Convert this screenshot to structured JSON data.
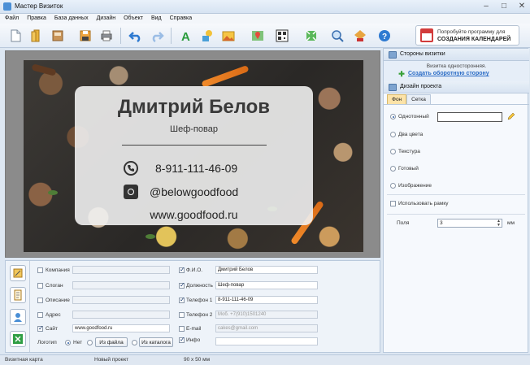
{
  "window": {
    "title": "Мастер Визиток"
  },
  "menu": [
    "Файл",
    "Правка",
    "База данных",
    "Дизайн",
    "Объект",
    "Вид",
    "Справка"
  ],
  "toolbar": {
    "icons": [
      "new-file-icon",
      "open-folder-icon",
      "templates-icon",
      "save-icon",
      "print-icon",
      "undo-icon",
      "redo-icon",
      "text-icon",
      "shapes-icon",
      "image-icon",
      "map-icon",
      "qr-code-icon",
      "fit-icon",
      "zoom-icon",
      "export-icon",
      "help-icon"
    ],
    "promo_line1": "Попробуйте программу для",
    "promo_line2": "СОЗДАНИЯ КАЛЕНДАРЕЙ"
  },
  "card": {
    "name": "Дмитрий Белов",
    "position": "Шеф-повар",
    "phone": "8-911-111-46-09",
    "instagram": "@belowgoodfood",
    "site": "www.goodfood.ru"
  },
  "right_panel": {
    "sides_header": "Стороны визитки",
    "sides_info": "Визитка односторонняя.",
    "sides_link": "Создать оборотную сторону",
    "design_header": "Дизайн проекта",
    "tabs": [
      "Фон",
      "Сетка"
    ],
    "background_options": [
      "Однотонный",
      "Два цвета",
      "Текстура",
      "Готовый",
      "Изображение"
    ],
    "selected_option": "Однотонный",
    "use_frame_label": "Использовать рамку",
    "margins_label": "Поля",
    "margins_value": "3",
    "margins_unit": "мм"
  },
  "fields": {
    "left": [
      {
        "label": "Компания",
        "value": "",
        "checked": false
      },
      {
        "label": "Слоган",
        "value": "",
        "checked": false
      },
      {
        "label": "Описание",
        "value": "",
        "checked": false
      },
      {
        "label": "Адрес",
        "value": "",
        "checked": false
      },
      {
        "label": "Сайт",
        "value": "www.goodfood.ru",
        "checked": true
      }
    ],
    "right": [
      {
        "label": "Ф.И.О.",
        "value": "Дмитрий Белов",
        "placeholder": "",
        "checked": true
      },
      {
        "label": "Должность",
        "value": "Шеф-повар",
        "placeholder": "",
        "checked": true
      },
      {
        "label": "Телефон 1",
        "value": "8-911-111-46-09",
        "placeholder": "",
        "checked": true
      },
      {
        "label": "Телефон 2",
        "value": "",
        "placeholder": "Моб. +7(910)1501240",
        "checked": false
      },
      {
        "label": "E-mail",
        "value": "",
        "placeholder": "cakes@gmail.com",
        "checked": false
      },
      {
        "label": "Инфо",
        "value": "",
        "placeholder": "",
        "checked": true
      }
    ],
    "logo_label": "Логотип",
    "logo_no": "Нет",
    "logo_from_file": "Из файла",
    "logo_from_catalog": "Из каталога"
  },
  "status": {
    "type": "Визитная карта",
    "project": "Новый проект",
    "size": "90 x 50 мм"
  },
  "colors": {
    "accent": "#2a6bc5",
    "tab_active": "#fce3a8",
    "panel_bg": "#f6f9fd"
  }
}
